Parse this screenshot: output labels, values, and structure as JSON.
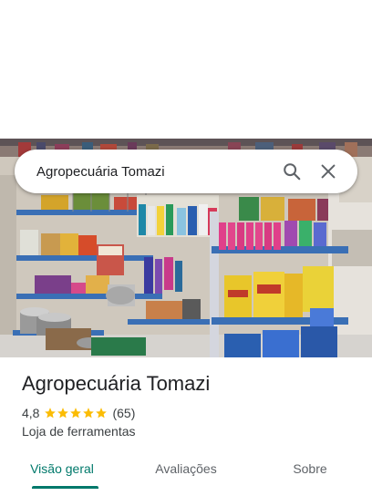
{
  "search": {
    "query": "Agropecuária Tomazi",
    "search_icon": "search-icon",
    "close_icon": "close-icon"
  },
  "photo": {
    "description_icon": "store-photo"
  },
  "place": {
    "name": "Agropecuária Tomazi",
    "rating": "4,8",
    "stars": 4.8,
    "star_color": "#fbbc04",
    "reviews": "(65)",
    "category": "Loja de ferramentas"
  },
  "tabs": [
    {
      "label": "Visão geral",
      "active": true
    },
    {
      "label": "Avaliações",
      "active": false
    },
    {
      "label": "Sobre",
      "active": false
    }
  ],
  "colors": {
    "accent": "#00796b",
    "text_primary": "#202124",
    "text_secondary": "#3c4043"
  }
}
